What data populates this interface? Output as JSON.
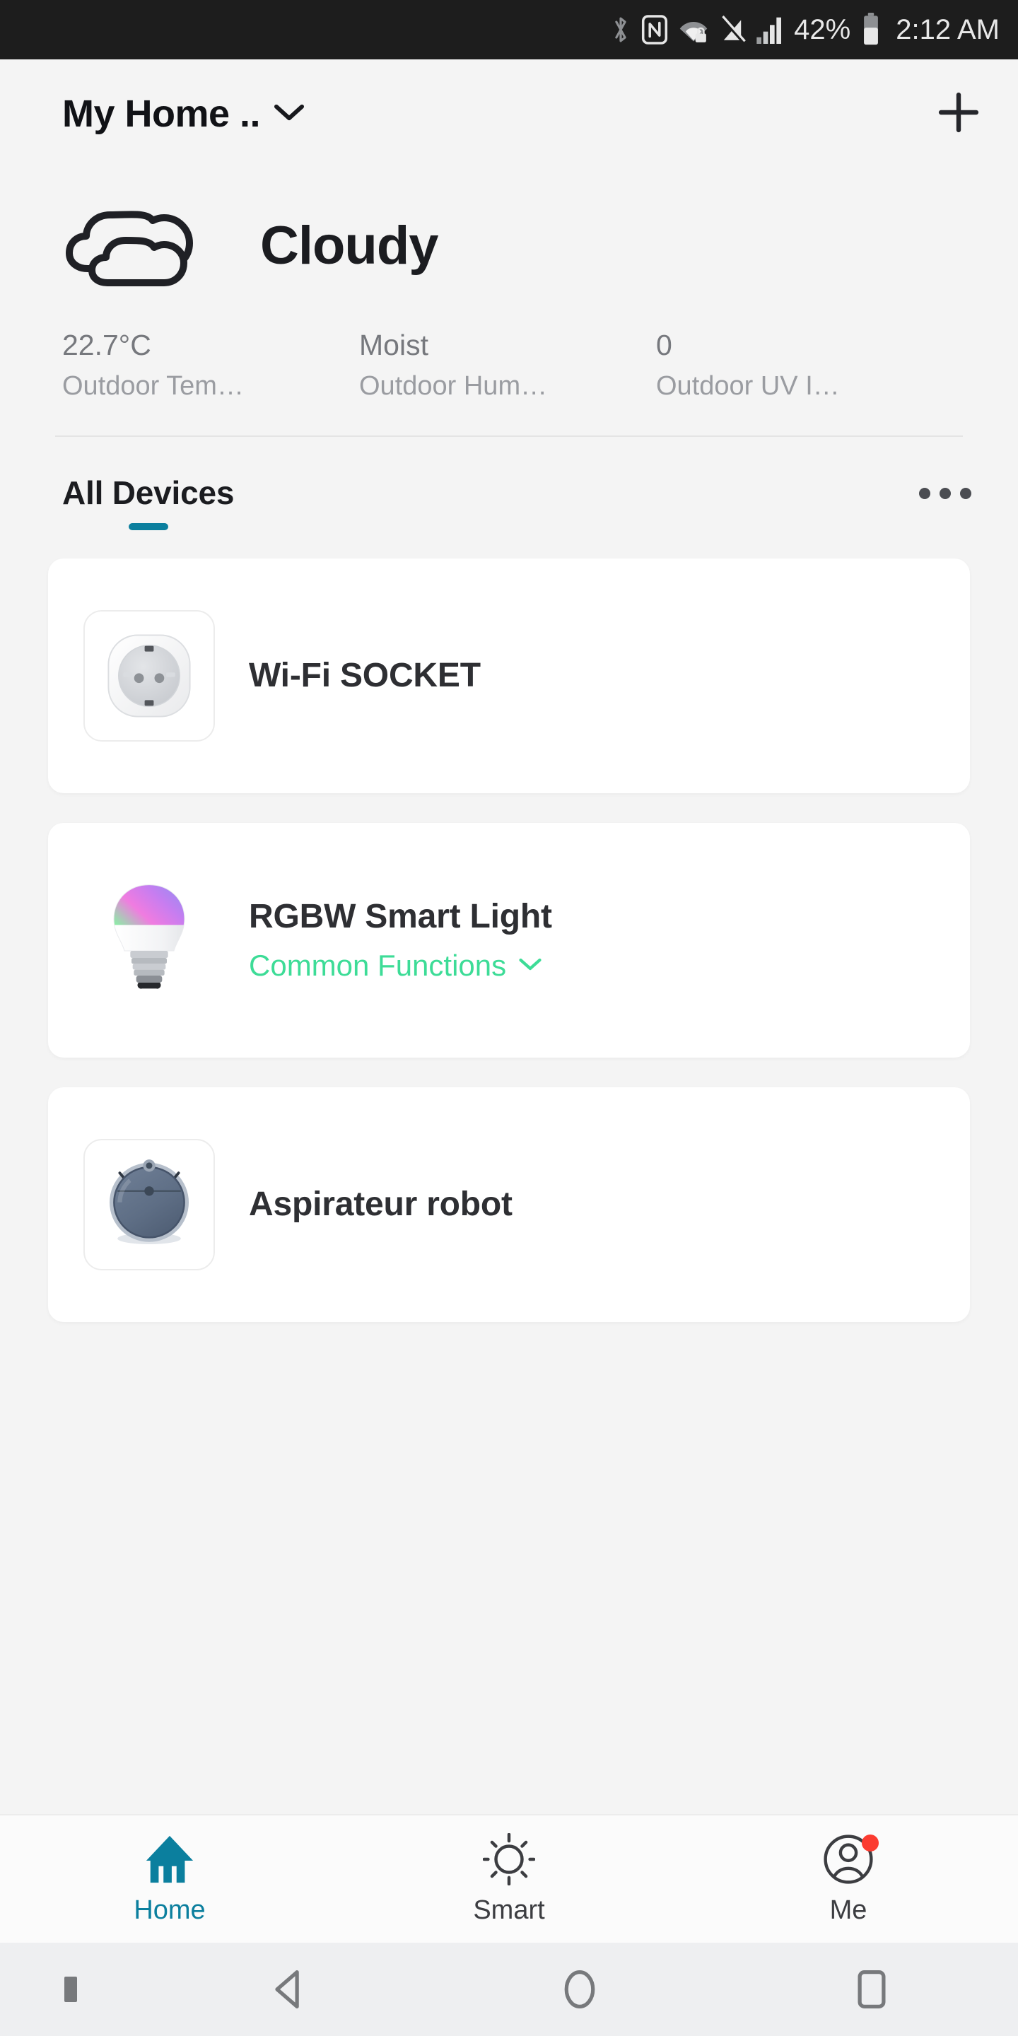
{
  "status_bar": {
    "icons": [
      "bluetooth-icon",
      "nfc-icon",
      "wifi-lock-icon",
      "sound-off-icon",
      "signal-bars-icon"
    ],
    "battery_percent": "42%",
    "battery_icon": "battery-icon",
    "clock": "2:12 AM",
    "background_color": "#1d1d1d"
  },
  "header": {
    "home_name": "My Home ..",
    "dropdown_icon": "chevron-down-icon",
    "add_icon": "plus-icon"
  },
  "weather": {
    "icon": "cloudy-icon",
    "condition": "Cloudy",
    "stats": [
      {
        "value": "22.7°C",
        "label": "Outdoor Tem…"
      },
      {
        "value": "Moist",
        "label": "Outdoor Hum…"
      },
      {
        "value": "0",
        "label": "Outdoor UV I…"
      }
    ]
  },
  "tabs": {
    "items": [
      {
        "label": "All Devices",
        "active": true
      }
    ],
    "more_icon": "more-horizontal-icon",
    "active_color": "#0b7f9e"
  },
  "devices": [
    {
      "name": "Wi-Fi SOCKET",
      "icon": "wifi-socket-icon",
      "subtitle": null,
      "subtitle_icon": null
    },
    {
      "name": "RGBW Smart Light",
      "icon": "smart-bulb-icon",
      "subtitle": "Common Functions",
      "subtitle_icon": "chevron-down-icon",
      "subtitle_color": "#3ddc97"
    },
    {
      "name": "Aspirateur robot",
      "icon": "robot-vacuum-icon",
      "subtitle": null,
      "subtitle_icon": null
    }
  ],
  "bottom_nav": {
    "items": [
      {
        "label": "Home",
        "icon": "home-icon",
        "active": true,
        "badge": false
      },
      {
        "label": "Smart",
        "icon": "sun-icon",
        "active": false,
        "badge": false
      },
      {
        "label": "Me",
        "icon": "account-icon",
        "active": false,
        "badge": true
      }
    ],
    "badge_color": "#fb3b30",
    "active_color": "#0b7f9e"
  },
  "android_nav": {
    "items": [
      "keyboard-hide-icon",
      "back-icon",
      "home-circle-icon",
      "recents-icon"
    ]
  }
}
